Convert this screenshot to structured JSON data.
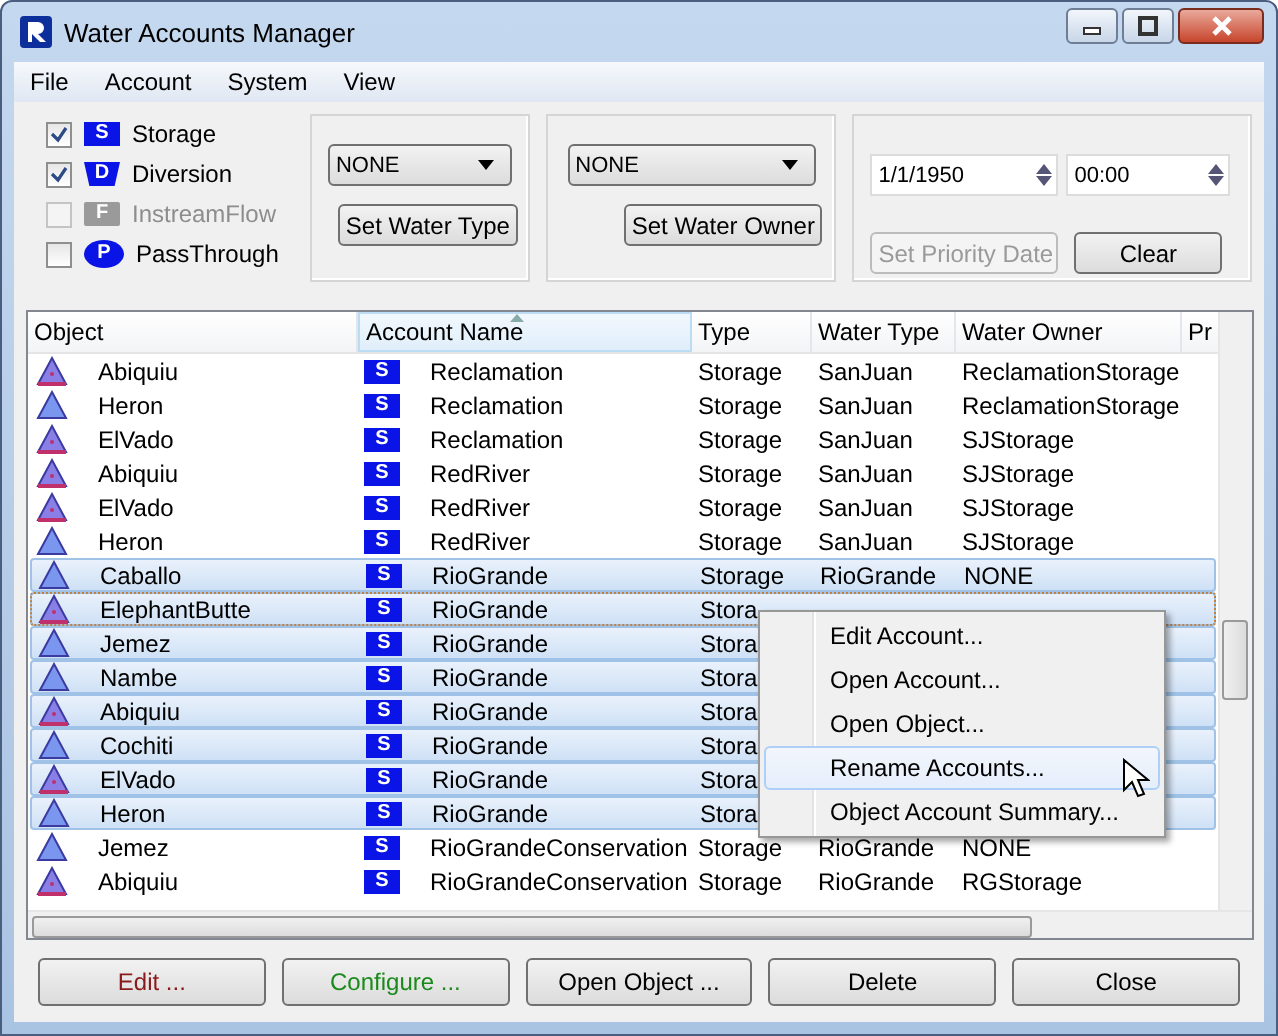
{
  "window": {
    "title": "Water Accounts Manager"
  },
  "menu": [
    "File",
    "Account",
    "System",
    "View"
  ],
  "filters": [
    {
      "label": "Storage",
      "badge": "S",
      "kind": "square",
      "checked": true,
      "disabled": false
    },
    {
      "label": "Diversion",
      "badge": "D",
      "kind": "shield",
      "checked": true,
      "disabled": false
    },
    {
      "label": "InstreamFlow",
      "badge": "F",
      "kind": "tag",
      "checked": false,
      "disabled": true
    },
    {
      "label": "PassThrough",
      "badge": "P",
      "kind": "oval",
      "checked": false,
      "disabled": false
    }
  ],
  "water_type": {
    "value": "NONE",
    "button": "Set Water Type"
  },
  "water_owner": {
    "value": "NONE",
    "button": "Set Water Owner"
  },
  "priority": {
    "date": "1/1/1950",
    "time": "00:00",
    "set_button": {
      "label": "Set Priority Date",
      "disabled": true
    },
    "clear_button": "Clear"
  },
  "table": {
    "columns": [
      "Object",
      "Account Name",
      "Type",
      "Water Type",
      "Water Owner",
      "Pr"
    ],
    "rows": [
      {
        "object": "Abiquiu",
        "kind": "marked",
        "badge": "S",
        "account": "Reclamation",
        "type": "Storage",
        "water_type": "SanJuan",
        "water_owner": "ReclamationStorage",
        "selected": false
      },
      {
        "object": "Heron",
        "kind": "plain",
        "badge": "S",
        "account": "Reclamation",
        "type": "Storage",
        "water_type": "SanJuan",
        "water_owner": "ReclamationStorage",
        "selected": false
      },
      {
        "object": "ElVado",
        "kind": "marked",
        "badge": "S",
        "account": "Reclamation",
        "type": "Storage",
        "water_type": "SanJuan",
        "water_owner": "SJStorage",
        "selected": false
      },
      {
        "object": "Abiquiu",
        "kind": "marked",
        "badge": "S",
        "account": "RedRiver",
        "type": "Storage",
        "water_type": "SanJuan",
        "water_owner": "SJStorage",
        "selected": false
      },
      {
        "object": "ElVado",
        "kind": "marked",
        "badge": "S",
        "account": "RedRiver",
        "type": "Storage",
        "water_type": "SanJuan",
        "water_owner": "SJStorage",
        "selected": false
      },
      {
        "object": "Heron",
        "kind": "plain",
        "badge": "S",
        "account": "RedRiver",
        "type": "Storage",
        "water_type": "SanJuan",
        "water_owner": "SJStorage",
        "selected": false
      },
      {
        "object": "Caballo",
        "kind": "plain",
        "badge": "S",
        "account": "RioGrande",
        "type": "Storage",
        "water_type": "RioGrande",
        "water_owner": "NONE",
        "selected": true
      },
      {
        "object": "ElephantButte",
        "kind": "marked",
        "badge": "S",
        "account": "RioGrande",
        "type": "Stora",
        "selected": true
      },
      {
        "object": "Jemez",
        "kind": "plain",
        "badge": "S",
        "account": "RioGrande",
        "type": "Stora",
        "selected": true
      },
      {
        "object": "Nambe",
        "kind": "plain",
        "badge": "S",
        "account": "RioGrande",
        "type": "Stora",
        "selected": true
      },
      {
        "object": "Abiquiu",
        "kind": "marked",
        "badge": "S",
        "account": "RioGrande",
        "type": "Stora",
        "selected": true
      },
      {
        "object": "Cochiti",
        "kind": "plain",
        "badge": "S",
        "account": "RioGrande",
        "type": "Stora",
        "selected": true
      },
      {
        "object": "ElVado",
        "kind": "marked",
        "badge": "S",
        "account": "RioGrande",
        "type": "Stora",
        "selected": true
      },
      {
        "object": "Heron",
        "kind": "plain",
        "badge": "S",
        "account": "RioGrande",
        "type": "Stora",
        "selected": true
      },
      {
        "object": "Jemez",
        "kind": "plain",
        "badge": "S",
        "account": "RioGrandeConservation",
        "type": "Storage",
        "water_type": "RioGrande",
        "water_owner": "NONE",
        "selected": false
      },
      {
        "object": "Abiquiu",
        "kind": "marked",
        "badge": "S",
        "account": "RioGrandeConservation",
        "type": "Storage",
        "water_type": "RioGrande",
        "water_owner": "RGStorage",
        "selected": false
      }
    ]
  },
  "context_menu": [
    {
      "label": "Edit Account...",
      "highlighted": false
    },
    {
      "label": "Open Account...",
      "highlighted": false
    },
    {
      "label": "Open Object...",
      "highlighted": false
    },
    {
      "label": "Rename Accounts...",
      "highlighted": true
    },
    {
      "label": "Object Account Summary...",
      "highlighted": false
    }
  ],
  "buttons": [
    {
      "label": "Edit ...",
      "color": "#8b1a1a"
    },
    {
      "label": "Configure ...",
      "color": "#1a8a1a"
    },
    {
      "label": "Open Object ...",
      "color": "#000000"
    },
    {
      "label": "Delete",
      "color": "#000000"
    },
    {
      "label": "Close",
      "color": "#000000"
    }
  ]
}
